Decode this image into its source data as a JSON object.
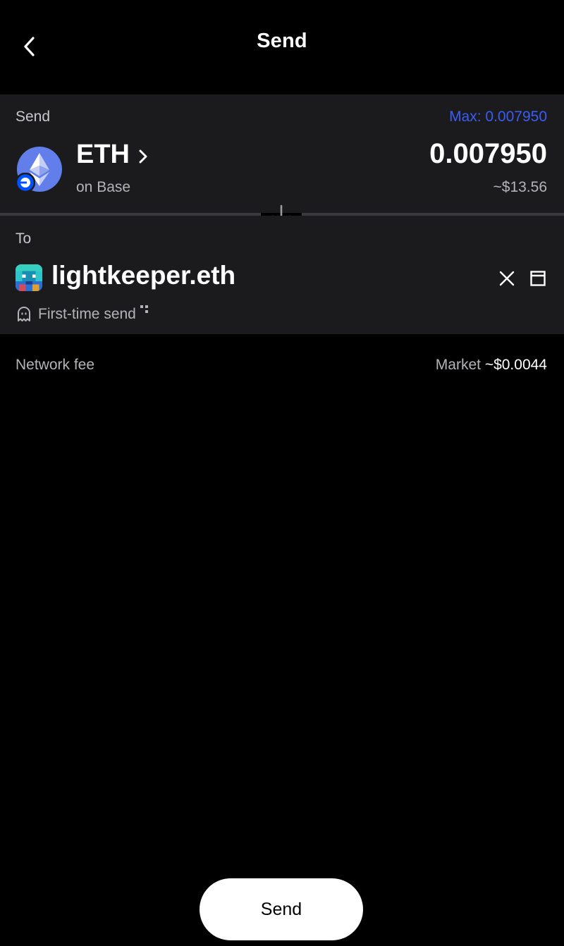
{
  "header": {
    "title": "Send",
    "back_icon": "chevron-left-icon"
  },
  "send_section": {
    "label": "Send",
    "max_label": "Max: 0.007950",
    "token_symbol": "ETH",
    "token_network": "on Base",
    "amount": "0.007950",
    "amount_usd": "~$13.56",
    "token_icon": "ethereum-icon",
    "network_badge_icon": "base-network-icon"
  },
  "to_section": {
    "label": "To",
    "recipient": "lightkeeper.eth",
    "first_time_label": "First-time send",
    "avatar_icon": "pixel-avatar-icon",
    "clear_icon": "close-icon",
    "save_icon": "save-contact-icon",
    "ghost_icon": "ghost-icon"
  },
  "network_fee": {
    "label": "Network fee",
    "speed": "Market",
    "amount": "~$0.0044"
  },
  "actions": {
    "send_label": "Send"
  },
  "colors": {
    "background": "#000000",
    "card": "#1b1b1d",
    "accent_blue": "#3b5cf6",
    "eth_blue": "#627eea",
    "muted_text": "#b4b4b8"
  }
}
